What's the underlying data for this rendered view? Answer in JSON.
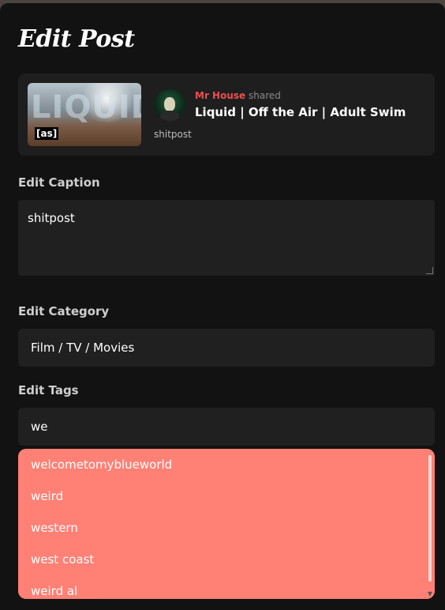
{
  "modal": {
    "title": "Edit Post"
  },
  "post": {
    "thumbnail_text": "LIQUID",
    "thumbnail_badge": "[as]",
    "author": "Mr House",
    "action": "shared",
    "title": "Liquid | Off the Air | Adult Swim",
    "caption": "shitpost"
  },
  "form": {
    "caption_label": "Edit Caption",
    "caption_value": "shitpost",
    "category_label": "Edit Category",
    "category_value": "Film / TV / Movies",
    "tags_label": "Edit Tags",
    "tags_value": "we"
  },
  "tag_suggestions": [
    "welcometomyblueworld",
    "weird",
    "western",
    "west coast",
    "weird al"
  ],
  "colors": {
    "accent_red": "#ee4f4f",
    "dropdown_bg": "#ff8075",
    "modal_bg": "#121212"
  }
}
